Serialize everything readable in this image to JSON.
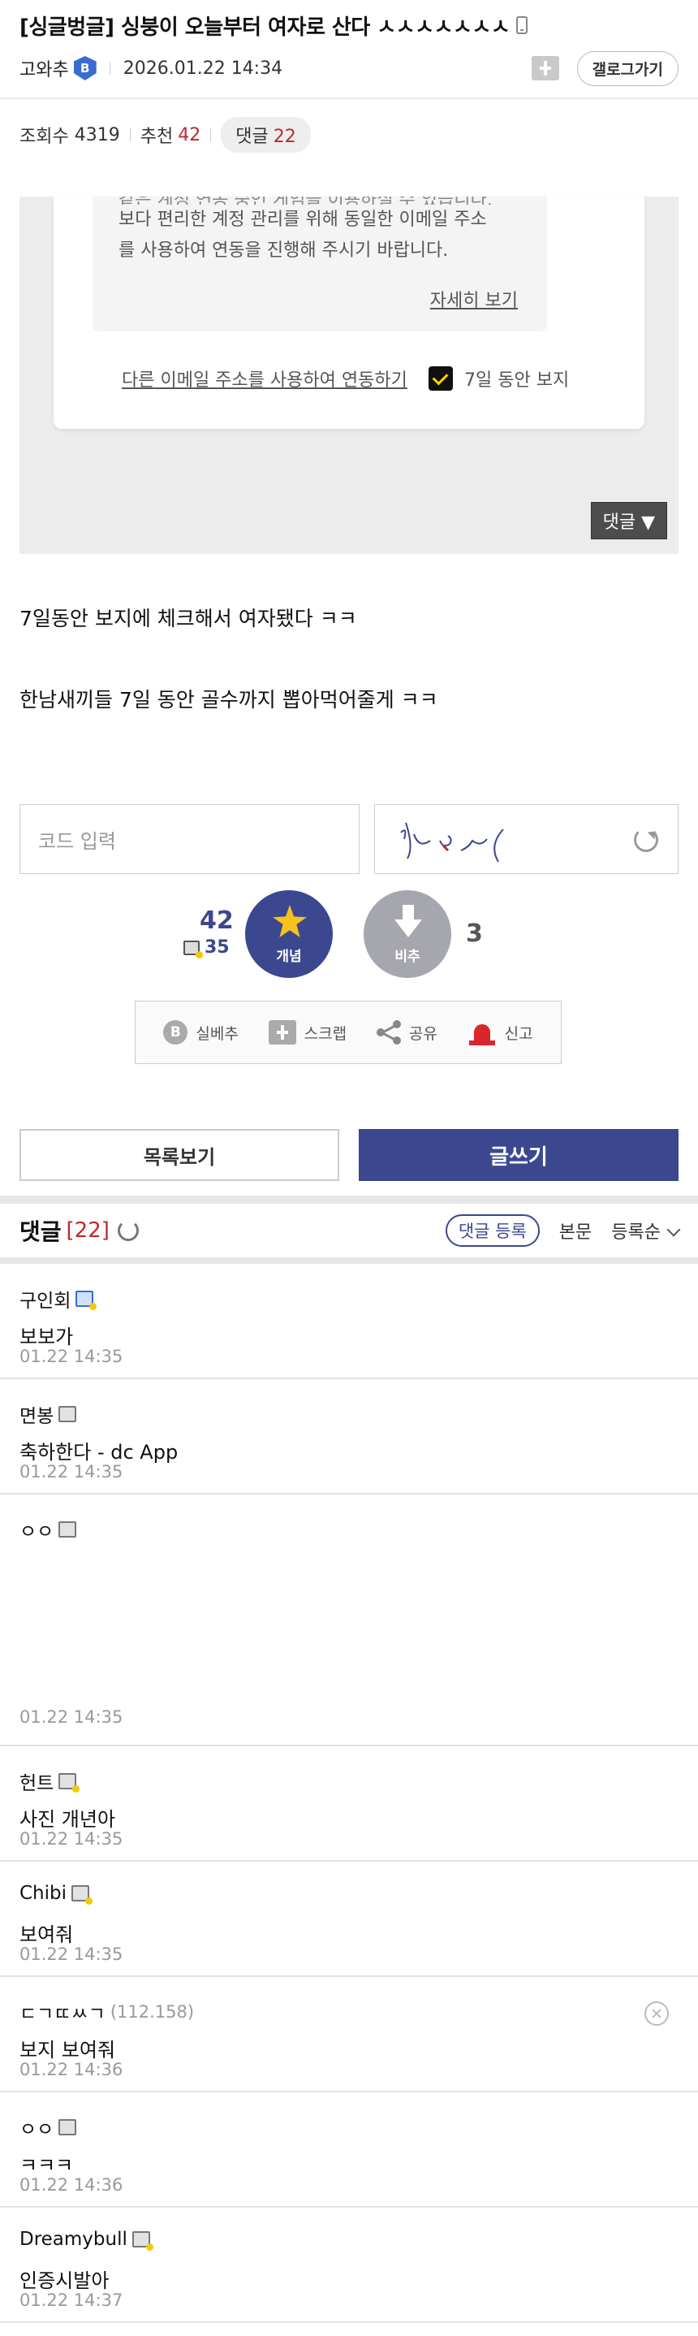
{
  "post": {
    "title": "[싱글벙글] 싱붕이 오늘부터 여자로 산다 ㅅㅅㅅㅅㅅㅅㅅ",
    "author": "고와추",
    "author_badge": "B",
    "date": "2026.01.22 14:34",
    "gallery_button": "갤로그가기"
  },
  "stats": {
    "views_label": "조회수",
    "views": "4319",
    "recommend_label": "추천",
    "recommend": "42",
    "comments_label": "댓글",
    "comments": "22"
  },
  "screenshot": {
    "line_cut": "같은 계정 연동 중인 게임을 이용하실 수 있습니다.",
    "line1": "보다 편리한 계정 관리를 위해 동일한 이메일 주소",
    "line2": "를 사용하여 연동을 진행해 주시기 바랍니다.",
    "detail_link": "자세히 보기",
    "other_email_link": "다른 이메일 주소를 사용하여 연동하기",
    "hide_7days": "7일 동안 보지",
    "comment_toggle": "댓글 ▼"
  },
  "body": {
    "line1": "7일동안 보지에 체크해서 여자됐다 ㅋㅋ",
    "line2": "한남새끼들 7일 동안 골수까지 뽑아먹어줄게 ㅋㅋ"
  },
  "captcha": {
    "placeholder": "코드 입력",
    "image_text": "si(¸_(¸~("
  },
  "vote": {
    "up_count": "42",
    "fixed_count": "35",
    "up_label": "개념",
    "down_label": "비추",
    "down_count": "3"
  },
  "actions": {
    "silbe": "실베추",
    "scrap": "스크랩",
    "share": "공유",
    "report": "신고"
  },
  "buttons": {
    "list": "목록보기",
    "write": "글쓰기"
  },
  "comment_header": {
    "title": "댓글",
    "count": "[22]",
    "register": "댓글 등록",
    "body": "본문",
    "sort": "등록순"
  },
  "comments": [
    {
      "name": "구인회",
      "ip": "",
      "text": "보보가",
      "time": "01.22 14:35"
    },
    {
      "name": "면봉",
      "ip": "",
      "text": "축하한다 - dc App",
      "time": "01.22 14:35"
    },
    {
      "name": "ㅇㅇ",
      "ip": "",
      "text": "",
      "time": "01.22 14:35"
    },
    {
      "name": "헌트",
      "ip": "",
      "text": "사진 개년아",
      "time": "01.22 14:35"
    },
    {
      "name": "Chibi",
      "ip": "",
      "text": "보여줘",
      "time": "01.22 14:35"
    },
    {
      "name": "ㄷㄱㄸㅆㄱ",
      "ip": "(112.158)",
      "text": "보지 보여줘",
      "time": "01.22 14:36"
    },
    {
      "name": "ㅇㅇ",
      "ip": "",
      "text": "ㅋㅋㅋ",
      "time": "01.22 14:36"
    },
    {
      "name": "Dreamybull",
      "ip": "",
      "text": "인증시발아",
      "time": "01.22 14:37"
    }
  ],
  "colors": {
    "brand_navy": "#3b4890",
    "accent_red": "#c2272d",
    "badge_blue": "#3b6bd1",
    "star_yellow": "#f7c21d"
  }
}
